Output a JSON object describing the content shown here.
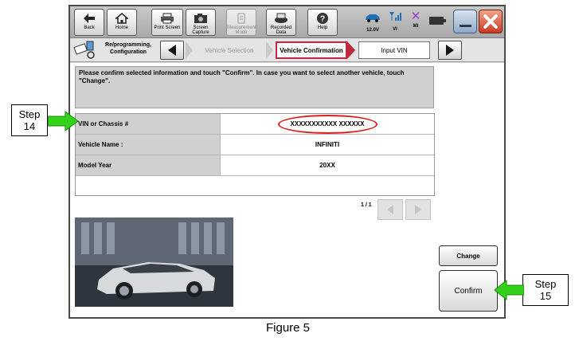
{
  "toolbar": {
    "back": "Back",
    "home": "Home",
    "print_screen": "Print Screen",
    "screen_capture": "Screen Capture",
    "measurement_mode": "Measurement Mode",
    "recorded_data": "Recorded Data",
    "help": "Help",
    "voltage": "12.0V",
    "vi": "VI",
    "mi": "MI"
  },
  "breadcrumb": {
    "reprogramming": "Re/programming, Configuration",
    "vehicle_selection": "Vehicle Selection",
    "vehicle_confirmation": "Vehicle Confirmation",
    "input_vin": "Input VIN"
  },
  "message": "Please confirm selected information and touch \"Confirm\". In case you want to select another vehicle, touch \"Change\".",
  "table": {
    "rows": [
      {
        "label": "VIN or Chassis #",
        "value": "XXXXXXXXXXX XXXXXX"
      },
      {
        "label": "Vehicle Name :",
        "value": "INFINITI"
      },
      {
        "label": "Model Year",
        "value": "20XX"
      }
    ]
  },
  "pager": "1 / 1",
  "buttons": {
    "change": "Change",
    "confirm": "Confirm"
  },
  "steps": {
    "step14_word": "Step",
    "step14_num": "14",
    "step15_word": "Step",
    "step15_num": "15"
  },
  "caption": "Figure 5",
  "colors": {
    "highlight_red": "#e0201f",
    "arrow_green": "#33d11a",
    "active_crumb_red": "#c0283d"
  }
}
